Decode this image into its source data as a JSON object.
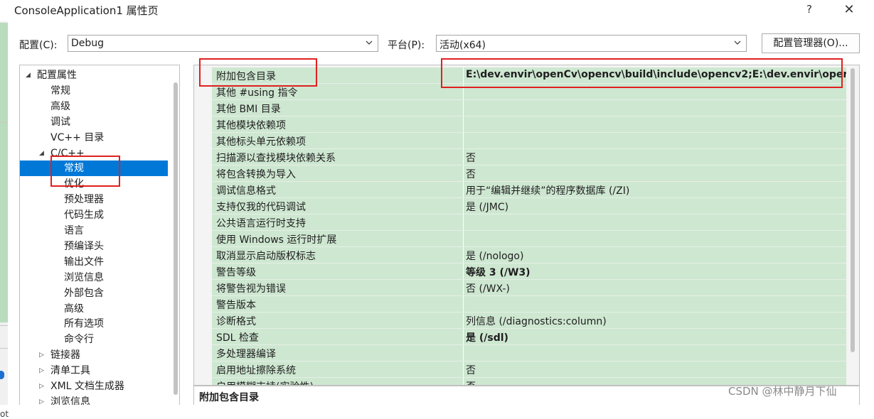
{
  "window": {
    "title": "ConsoleApplication1 属性页",
    "help_glyph": "?",
    "close_glyph": "✕"
  },
  "config": {
    "config_label": "配置(C):",
    "config_value": "Debug",
    "platform_label": "平台(P):",
    "platform_value": "活动(x64)",
    "manager_button": "配置管理器(O)..."
  },
  "tree": {
    "items": [
      {
        "label": "配置属性",
        "level": 0,
        "expander": "▲"
      },
      {
        "label": "常规",
        "level": 1
      },
      {
        "label": "高级",
        "level": 1
      },
      {
        "label": "调试",
        "level": 1
      },
      {
        "label": "VC++ 目录",
        "level": 1
      },
      {
        "label": "C/C++",
        "level": 1,
        "expander": "▲"
      },
      {
        "label": "常规",
        "level": 2,
        "selected": true
      },
      {
        "label": "优化",
        "level": 2
      },
      {
        "label": "预处理器",
        "level": 2
      },
      {
        "label": "代码生成",
        "level": 2
      },
      {
        "label": "语言",
        "level": 2
      },
      {
        "label": "预编译头",
        "level": 2
      },
      {
        "label": "输出文件",
        "level": 2
      },
      {
        "label": "浏览信息",
        "level": 2
      },
      {
        "label": "外部包含",
        "level": 2
      },
      {
        "label": "高级",
        "level": 2
      },
      {
        "label": "所有选项",
        "level": 2
      },
      {
        "label": "命令行",
        "level": 2
      },
      {
        "label": "链接器",
        "level": 1,
        "expander": "▷"
      },
      {
        "label": "清单工具",
        "level": 1,
        "expander": "▷"
      },
      {
        "label": "XML 文档生成器",
        "level": 1,
        "expander": "▷"
      },
      {
        "label": "浏览信息",
        "level": 1,
        "expander": "▷"
      }
    ]
  },
  "properties": {
    "rows": [
      {
        "name": "附加包含目录",
        "value": "E:\\dev.envir\\openCv\\opencv\\build\\include\\opencv2;E:\\dev.envir\\oper",
        "bold": true
      },
      {
        "name": "其他 #using 指令",
        "value": ""
      },
      {
        "name": "其他 BMI 目录",
        "value": ""
      },
      {
        "name": "其他模块依赖项",
        "value": ""
      },
      {
        "name": "其他标头单元依赖项",
        "value": ""
      },
      {
        "name": "扫描源以查找模块依赖关系",
        "value": "否"
      },
      {
        "name": "将包含转换为导入",
        "value": "否"
      },
      {
        "name": "调试信息格式",
        "value": "用于“编辑并继续”的程序数据库 (/ZI)"
      },
      {
        "name": "支持仅我的代码调试",
        "value": "是 (/JMC)"
      },
      {
        "name": "公共语言运行时支持",
        "value": ""
      },
      {
        "name": "使用 Windows 运行时扩展",
        "value": ""
      },
      {
        "name": "取消显示启动版权标志",
        "value": "是 (/nologo)"
      },
      {
        "name": "警告等级",
        "value": "等级 3 (/W3)",
        "bold": true
      },
      {
        "name": "将警告视为错误",
        "value": "否 (/WX-)"
      },
      {
        "name": "警告版本",
        "value": ""
      },
      {
        "name": "诊断格式",
        "value": "列信息 (/diagnostics:column)"
      },
      {
        "name": "SDL 检查",
        "value": "是 (/sdl)",
        "bold": true
      },
      {
        "name": "多处理器编译",
        "value": ""
      },
      {
        "name": "启用地址擦除系统",
        "value": "否"
      },
      {
        "name": "启用模糊支持(实验性)",
        "value": "否"
      }
    ]
  },
  "description": {
    "title": "附加包含目录"
  },
  "watermark": "CSDN @林中静月下仙"
}
